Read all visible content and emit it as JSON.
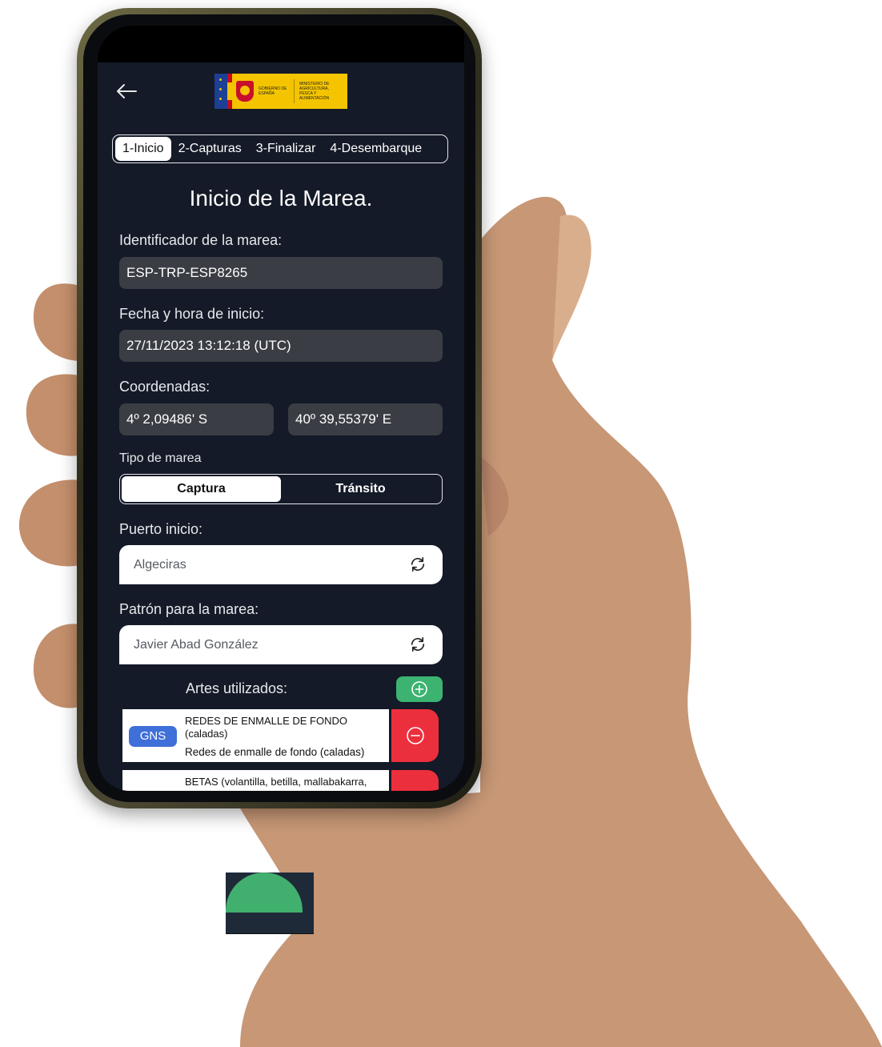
{
  "header": {
    "logo_text_left": "GOBIERNO DE ESPAÑA",
    "logo_text_right": "MINISTERIO DE AGRICULTURA, PESCA Y ALIMENTACIÓN"
  },
  "tabs": [
    {
      "label": "1-Inicio",
      "active": true
    },
    {
      "label": "2-Capturas",
      "active": false
    },
    {
      "label": "3-Finalizar",
      "active": false
    },
    {
      "label": "4-Desembarque",
      "active": false
    }
  ],
  "title": "Inicio de la Marea.",
  "identificador": {
    "label": "Identificador de la marea:",
    "value": "ESP-TRP-ESP8265"
  },
  "fecha": {
    "label": "Fecha y hora de inicio:",
    "value": "27/11/2023 13:12:18 (UTC)"
  },
  "coordenadas": {
    "label": "Coordenadas:",
    "lat": "4º 2,09486' S",
    "lon": "40º 39,55379' E"
  },
  "tipo_marea": {
    "label": "Tipo de marea",
    "options": [
      "Captura",
      "Tránsito"
    ],
    "selected": "Captura"
  },
  "puerto": {
    "label": "Puerto inicio:",
    "value": "Algeciras"
  },
  "patron": {
    "label": "Patrón para la marea:",
    "value": "Javier Abad González"
  },
  "artes": {
    "label": "Artes utilizados:",
    "items": [
      {
        "code": "GNS",
        "name": "REDES DE ENMALLE DE FONDO (caladas)",
        "desc": "Redes de enmalle de fondo (caladas)"
      },
      {
        "code": "",
        "name": "BETAS (volantilla, betilla, mallabakarra,",
        "desc": ""
      }
    ]
  },
  "colors": {
    "screen_bg": "#141a27",
    "field_bg": "#3a3d44",
    "add_green": "#3cb371",
    "delete_red": "#ec2f3c",
    "badge_blue": "#3f6fd8"
  }
}
